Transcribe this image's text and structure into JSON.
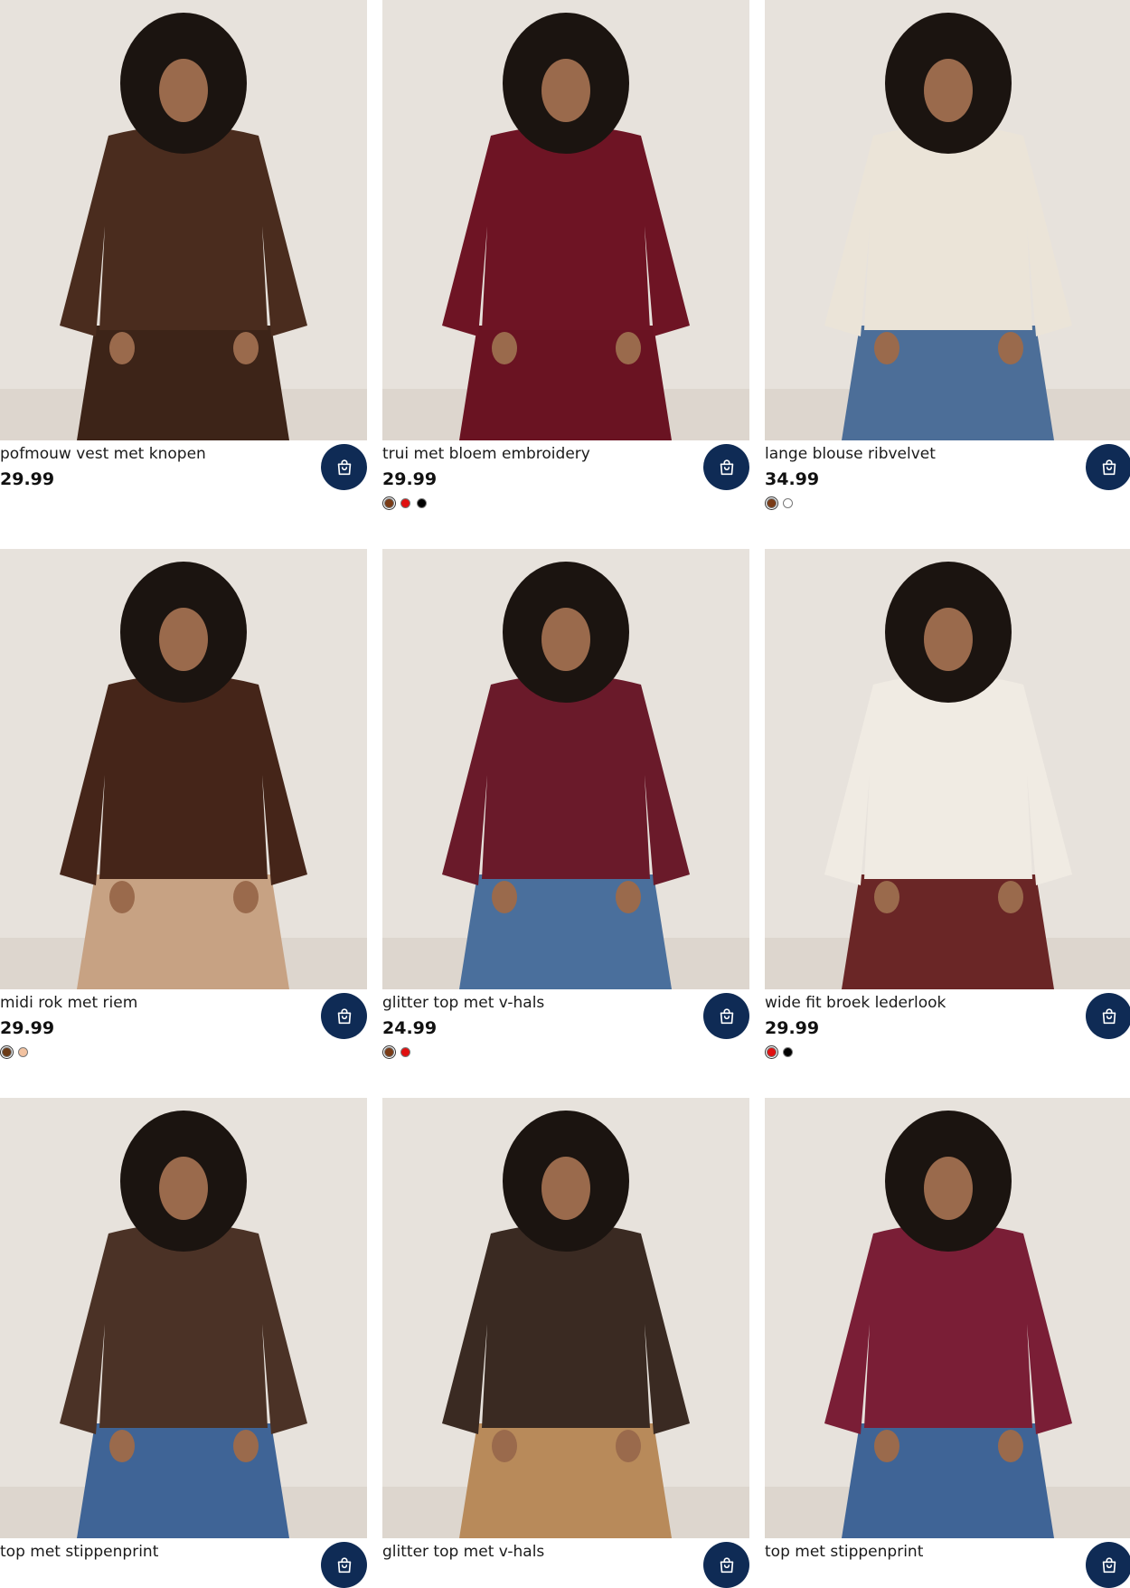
{
  "products": [
    {
      "title": "pofmouw vest met knopen",
      "price": "29.99",
      "swatches": [],
      "garment": "#4a2c1e",
      "pants": "#3d2418",
      "skin": "#9a6a4c"
    },
    {
      "title": "trui met bloem embroidery",
      "price": "29.99",
      "swatches": [
        "#7a3b16",
        "#e01010",
        "#000000"
      ],
      "garment": "#6e1424",
      "pants": "#6a1322",
      "skin": "#9a6a4c"
    },
    {
      "title": "lange blouse ribvelvet",
      "price": "34.99",
      "swatches": [
        "#7a3b16",
        "#ffffff"
      ],
      "garment": "#ebe4d8",
      "pants": "#4c6e98",
      "skin": "#9a6a4c"
    },
    {
      "title": "midi rok met riem",
      "price": "29.99",
      "swatches": [
        "#6b3a16",
        "#f2c2a0"
      ],
      "garment": "#452519",
      "pants": "#c7a283",
      "skin": "#9a6a4c"
    },
    {
      "title": "glitter top met v-hals",
      "price": "24.99",
      "swatches": [
        "#7a3b16",
        "#e01010"
      ],
      "garment": "#6a1a2a",
      "pants": "#4a6f9c",
      "skin": "#9a6a4c"
    },
    {
      "title": "wide fit broek lederlook",
      "price": "29.99",
      "swatches": [
        "#e01010",
        "#000000"
      ],
      "garment": "#f0ebe3",
      "pants": "#6a2626",
      "skin": "#9a6a4c"
    },
    {
      "title": "top met stippenprint",
      "price": "",
      "swatches": [],
      "garment": "#4b3226",
      "pants": "#3f6496",
      "skin": "#9a6a4c"
    },
    {
      "title": "glitter top met v-hals",
      "price": "",
      "swatches": [],
      "garment": "#3a2a22",
      "pants": "#b88a5a",
      "skin": "#9a6a4c"
    },
    {
      "title": "top met stippenprint",
      "price": "",
      "swatches": [],
      "garment": "#7a1e36",
      "pants": "#3f6496",
      "skin": "#9a6a4c"
    }
  ],
  "cart_button_icon": "shopping-bag-icon",
  "colors": {
    "cart_button": "#0f2b55",
    "photo_background": "#e7e2dc",
    "hair": "#1b1410"
  }
}
